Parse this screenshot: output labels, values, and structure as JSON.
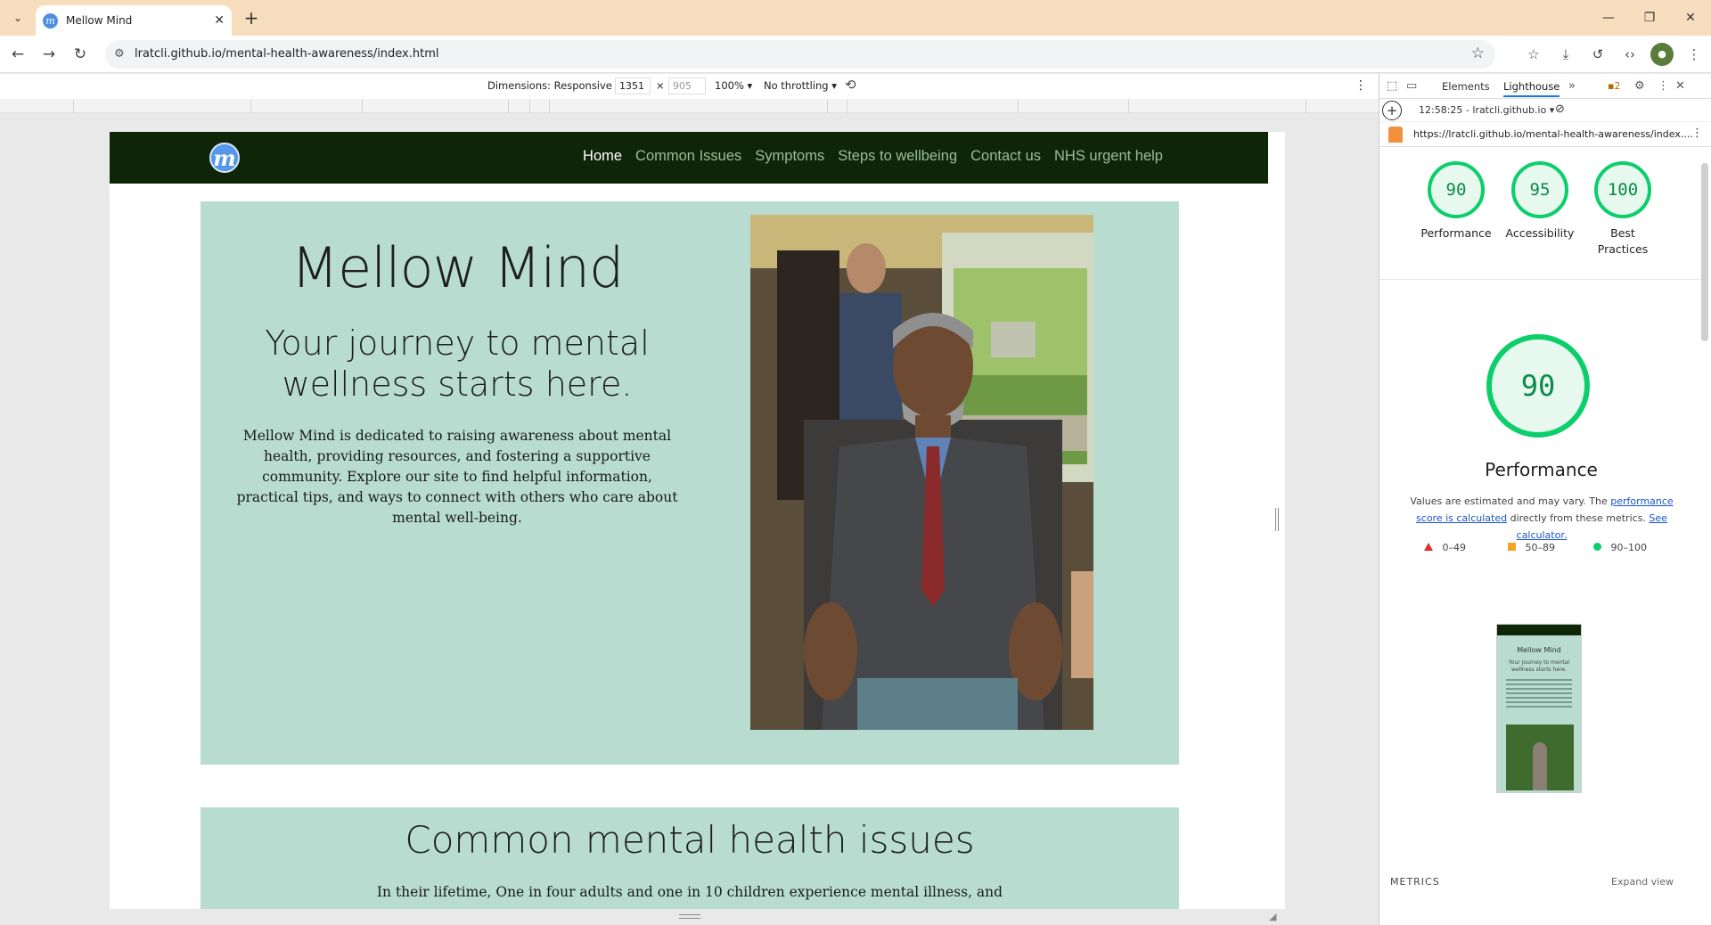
{
  "browser": {
    "tab_title": "Mellow Mind",
    "favicon_letter": "m",
    "url": "lratcli.github.io/mental-health-awareness/index.html"
  },
  "device_toolbar": {
    "dimensions_label": "Dimensions: Responsive ▾",
    "width": "1351",
    "height": "905",
    "times": "×",
    "zoom": "100% ▾",
    "throttling": "No throttling ▾"
  },
  "site": {
    "logo_letter": "m",
    "nav": [
      {
        "label": "Home",
        "active": true
      },
      {
        "label": "Common Issues",
        "active": false
      },
      {
        "label": "Symptoms",
        "active": false
      },
      {
        "label": "Steps to wellbeing",
        "active": false
      },
      {
        "label": "Contact us",
        "active": false
      },
      {
        "label": "NHS urgent help",
        "active": false
      }
    ],
    "hero": {
      "title": "Mellow Mind",
      "subtitle": "Your journey to mental wellness starts here.",
      "text": "Mellow Mind is dedicated to raising awareness about mental health, providing resources, and fostering a supportive community. Explore our site to find helpful information, practical tips, and ways to connect with others who care about mental well-being."
    },
    "issues": {
      "title": "Common mental health issues",
      "text": "In their lifetime, One in four adults and one in 10 children experience mental illness, and"
    }
  },
  "devtools": {
    "tabs": [
      "Elements",
      "Lighthouse"
    ],
    "active_tab": "Lighthouse",
    "issues_count": "2",
    "run_label": "12:58:25 - lratcli.github.io ▾",
    "report_url": "https://lratcli.github.io/mental-health-awareness/index....",
    "scores": [
      {
        "label": "Performance",
        "value": "90"
      },
      {
        "label": "Accessibility",
        "value": "95"
      },
      {
        "label": "Best Practices",
        "value": "100"
      }
    ],
    "main_score": {
      "label": "Performance",
      "value": "90"
    },
    "description_a": "Values are estimated and may vary. The ",
    "description_link1": "performance score is calculated",
    "description_b": " directly from these metrics. ",
    "description_link2": "See calculator.",
    "legend": [
      {
        "range": "0–49",
        "color": "#e02d2d"
      },
      {
        "range": "50–89",
        "color": "#f5a524"
      },
      {
        "range": "90–100",
        "color": "#0cce6b"
      }
    ],
    "thumbnail": {
      "title": "Mellow Mind",
      "subtitle": "Your journey to mental wellness starts here."
    },
    "metrics_heading": "METRICS",
    "expand_view": "Expand view"
  }
}
